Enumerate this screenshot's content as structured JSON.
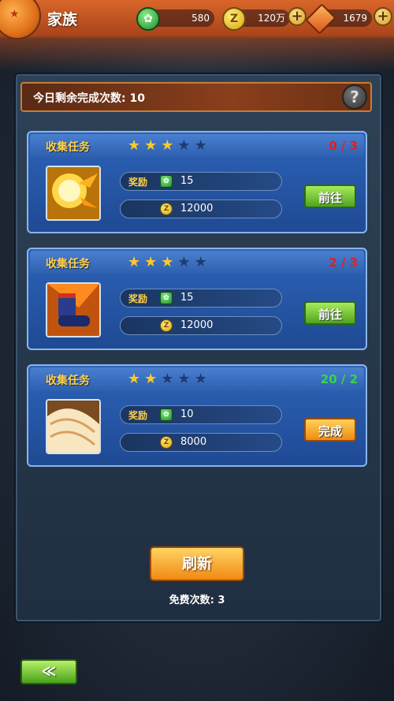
{
  "header": {
    "title": "家族",
    "resources": [
      {
        "icon": "green-jade-icon",
        "value": "580"
      },
      {
        "icon": "gold-coin-icon",
        "value": "120万"
      },
      {
        "icon": "orange-crystal-icon",
        "value": "1679"
      }
    ]
  },
  "panel": {
    "remaining_label": "今日剩余完成次数: 10",
    "help_label": "?"
  },
  "tasks": [
    {
      "title": "收集任务",
      "stars": 3,
      "max_stars": 5,
      "progress": "0 / 3",
      "progress_color": "#e02020",
      "reward_label": "奖励",
      "jade_reward": "15",
      "coin_reward": "12000",
      "action_label": "前往",
      "action_style": "green",
      "item_icon": "energy-blast-icon"
    },
    {
      "title": "收集任务",
      "stars": 3,
      "max_stars": 5,
      "progress": "2 / 3",
      "progress_color": "#e02020",
      "reward_label": "奖励",
      "jade_reward": "15",
      "coin_reward": "12000",
      "action_label": "前往",
      "action_style": "green",
      "item_icon": "boots-icon"
    },
    {
      "title": "收集任务",
      "stars": 2,
      "max_stars": 5,
      "progress": "20 / 2",
      "progress_color": "#36d64a",
      "reward_label": "奖励",
      "jade_reward": "10",
      "coin_reward": "8000",
      "action_label": "完成",
      "action_style": "orange",
      "item_icon": "feather-icon"
    }
  ],
  "footer": {
    "refresh_label": "刷新",
    "free_count_label": "免费次数: 3",
    "back_label": "≪"
  }
}
